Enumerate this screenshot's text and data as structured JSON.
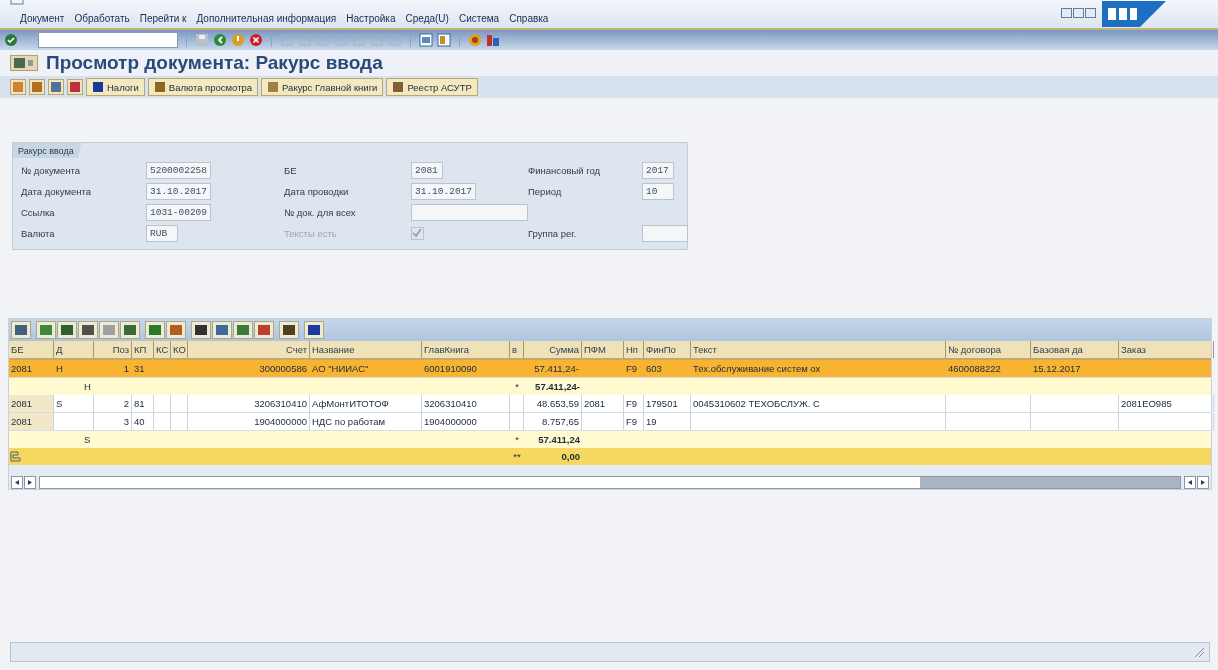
{
  "menu": [
    "Документ",
    "Обработать",
    "Перейти к",
    "Дополнительная информация",
    "Настройка",
    "Среда(U)",
    "Система",
    "Справка"
  ],
  "title": "Просмотр документа: Ракурс ввода",
  "app_toolbar": [
    "Налоги",
    "Валюта просмотра",
    "Ракурс Главной книги",
    "Реестр АСУТР"
  ],
  "header_panel": {
    "tab": "Ракурс ввода",
    "rows": [
      [
        {
          "label": "№ документа",
          "value": "5200002258"
        },
        {
          "label": "БЕ",
          "value": "2081"
        },
        {
          "label": "Финансовый год",
          "value": "2017"
        }
      ],
      [
        {
          "label": "Дата документа",
          "value": "31.10.2017"
        },
        {
          "label": "Дата проводки",
          "value": "31.10.2017"
        },
        {
          "label": "Период",
          "value": "10"
        }
      ],
      [
        {
          "label": "Ссылка",
          "value": "1031-00209"
        },
        {
          "label": "№ док. для всех"
        }
      ],
      [
        {
          "label": "Валюта",
          "value": "RUB"
        },
        {
          "label": "Тексты есть",
          "kind": "checkbox",
          "checked": true,
          "disabled": true
        },
        {
          "label": "Группа рег."
        }
      ]
    ]
  },
  "table": {
    "columns": [
      "БЕ",
      "Д",
      "Поз",
      "КП",
      "КС",
      "КО",
      "Счет",
      "Название",
      "ГлавКнига",
      "в",
      "Сумма",
      "ПФМ",
      "Нп",
      "ФинПо",
      "Текст",
      "№ договора",
      "Базовая да",
      "Заказ"
    ],
    "rows": [
      {
        "kind": "item",
        "selected": true,
        "cells": [
          "2081",
          "Н",
          "1",
          "31",
          "",
          "",
          "300000586",
          "АО \"НИИАС\"",
          "6001910090",
          "",
          "57.411,24-",
          "",
          "F9",
          "603",
          "Тех.обслуживание систем ох",
          "4600088222",
          "15.12.2017",
          ""
        ]
      },
      {
        "kind": "subtotal",
        "label": "Н",
        "marker": "*",
        "amount": "57.411,24-"
      },
      {
        "kind": "item",
        "selected": false,
        "cells": [
          "2081",
          "S",
          "2",
          "81",
          "",
          "",
          "3206310410",
          "АфМонтИТОТОФ",
          "3206310410",
          "",
          "48.653,59",
          "2081",
          "F9",
          "179501",
          "0045310602 ТЕХОБСЛУЖ. С",
          "",
          "",
          "2081EO985"
        ]
      },
      {
        "kind": "item",
        "selected": false,
        "cells": [
          "2081",
          "",
          "3",
          "40",
          "",
          "",
          "1904000000",
          "НДС по работам",
          "1904000000",
          "",
          "8.757,65",
          "",
          "F9",
          "19",
          "",
          "",
          "",
          ""
        ]
      },
      {
        "kind": "subtotal",
        "label": "S",
        "marker": "*",
        "amount": "57.411,24"
      },
      {
        "kind": "total",
        "marker": "**",
        "amount": "0,00"
      }
    ]
  }
}
